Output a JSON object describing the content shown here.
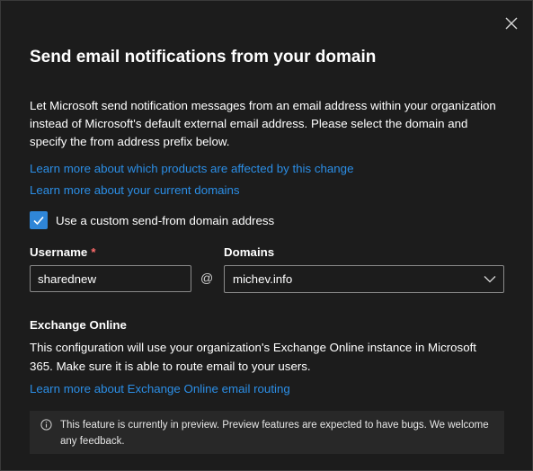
{
  "dialog": {
    "title": "Send email notifications from your domain",
    "description": "Let Microsoft send notification messages from an email address within your organization instead of Microsoft's default external email address. Please select the domain and specify the from address prefix below.",
    "links": {
      "products_affected": "Learn more about which products are affected by this change",
      "current_domains": "Learn more about your current domains",
      "exchange_routing": "Learn more about Exchange Online email routing"
    },
    "checkbox": {
      "label": "Use a custom send-from domain address",
      "checked": true
    },
    "username": {
      "label": "Username",
      "required_mark": "*",
      "value": "sharednew"
    },
    "at_symbol": "@",
    "domains": {
      "label": "Domains",
      "selected": "michev.info"
    },
    "exchange": {
      "title": "Exchange Online",
      "description": "This configuration will use your organization's Exchange Online instance in Microsoft 365. Make sure it is able to route email to your users."
    },
    "banner": {
      "text": "This feature is currently in preview. Preview features are expected to have bugs. We welcome any feedback."
    },
    "colors": {
      "accent": "#2f86d8",
      "link": "#2b8ee6",
      "background": "#1c1c1c"
    },
    "icons": {
      "close": "close-icon",
      "check": "checkmark-icon",
      "chevron": "chevron-down-icon",
      "info": "info-icon"
    }
  }
}
